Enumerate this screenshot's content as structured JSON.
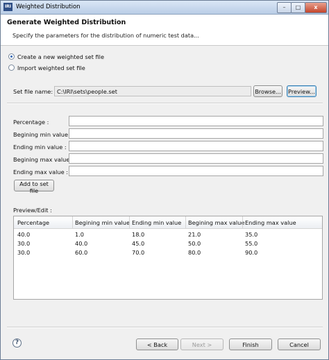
{
  "window": {
    "logo_text": "IRI",
    "title": "Weighted Distribution",
    "minimize_symbol": "–",
    "maximize_symbol": "□",
    "close_symbol": "x"
  },
  "header": {
    "title": "Generate Weighted Distribution",
    "description": "Specify the parameters for the distribution of numeric test data..."
  },
  "mode": {
    "options": [
      {
        "label": "Create a new weighted set file",
        "selected": true
      },
      {
        "label": "Import weighted set file",
        "selected": false
      }
    ]
  },
  "set_file": {
    "label": "Set file name:",
    "value": "C:\\IRI\\sets\\people.set",
    "browse_label": "Browse...",
    "preview_label": "Preview..."
  },
  "fields": [
    {
      "label": "Percentage :",
      "value": ""
    },
    {
      "label": "Begining min value :",
      "value": ""
    },
    {
      "label": "Ending min value :",
      "value": ""
    },
    {
      "label": "Begining max value :",
      "value": ""
    },
    {
      "label": "Ending max value :",
      "value": ""
    }
  ],
  "add_button_label": "Add to set file",
  "preview": {
    "label": "Preview/Edit :",
    "columns": [
      "Percentage",
      "Begining min value",
      "Ending min value",
      "Begining max value",
      "Ending max value"
    ],
    "rows": [
      [
        "40.0",
        "1.0",
        "18.0",
        "21.0",
        "35.0"
      ],
      [
        "30.0",
        "40.0",
        "45.0",
        "50.0",
        "55.0"
      ],
      [
        "30.0",
        "60.0",
        "70.0",
        "80.0",
        "90.0"
      ]
    ]
  },
  "footer": {
    "help_symbol": "?",
    "back_label": "< Back",
    "next_label": "Next >",
    "finish_label": "Finish",
    "cancel_label": "Cancel"
  }
}
